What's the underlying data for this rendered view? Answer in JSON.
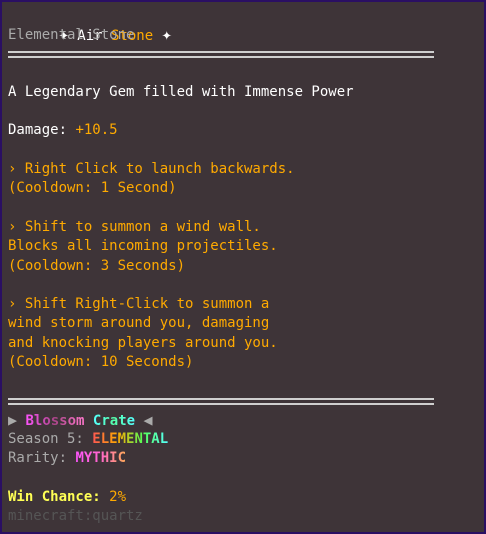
{
  "item": {
    "sparkle_left": "✦",
    "name_prefix": "Air",
    "name_suffix": "Stone",
    "sparkle_right": "✦",
    "subtitle": "Elemental Stone"
  },
  "description": "A Legendary Gem filled with Immense Power",
  "damage": {
    "label": "Damage:",
    "value": "+10.5"
  },
  "abilities": [
    {
      "lines": [
        "› Right Click to launch backwards."
      ],
      "cooldown": "(Cooldown: 1 Second)"
    },
    {
      "lines": [
        "› Shift to summon a wind wall.",
        "Blocks all incoming projectiles."
      ],
      "cooldown": "(Cooldown: 3 Seconds)"
    },
    {
      "lines": [
        "› Shift Right-Click to summon a",
        "wind storm around you, damaging",
        "and knocking players around you."
      ],
      "cooldown": "(Cooldown: 10 Seconds)"
    }
  ],
  "crate": {
    "arrow_left": "▶",
    "name_a": "Blossom",
    "name_b": "Crate",
    "arrow_right": "◀",
    "season_label": "Season 5:",
    "season_value": "ELEMENTAL",
    "rarity_label": "Rarity:",
    "rarity_value": "MYTHIC",
    "win_label": "Win Chance:",
    "win_value": "2%",
    "item_id": "minecraft:quartz"
  },
  "colors": {
    "background": "#3e3438",
    "border": "#2a0f63",
    "gold": "#ffaa00",
    "yellow": "#ffff55",
    "gray": "#aaaaaa",
    "dark_gray": "#555555"
  }
}
